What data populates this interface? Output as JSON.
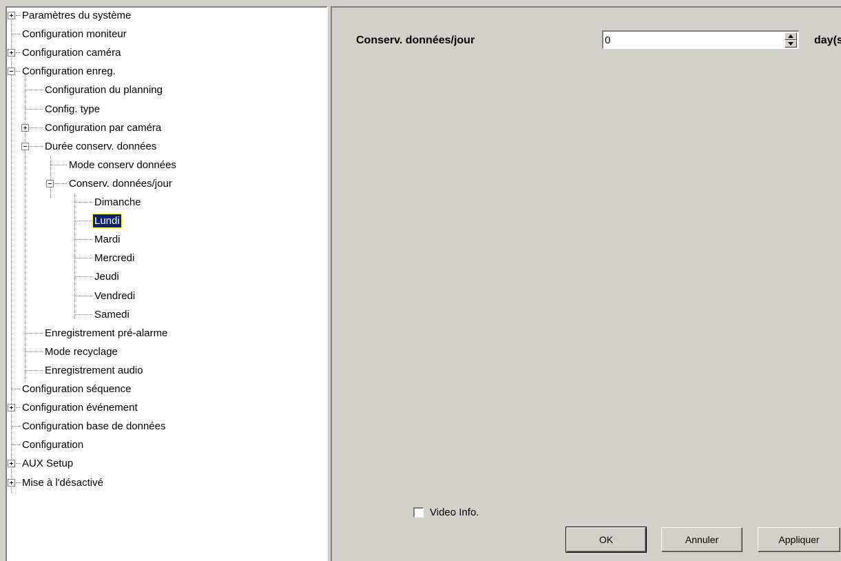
{
  "tree": {
    "nodes": [
      {
        "label": "Paramètres du système",
        "expander": "plus"
      },
      {
        "label": "Configuration moniteur",
        "expander": "none"
      },
      {
        "label": "Configuration caméra",
        "expander": "plus"
      },
      {
        "label": "Configuration enreg.",
        "expander": "minus"
      },
      {
        "label": "Configuration du planning",
        "expander": "none"
      },
      {
        "label": "Config. type",
        "expander": "none"
      },
      {
        "label": "Configuration par caméra",
        "expander": "plus"
      },
      {
        "label": "Durée conserv. données",
        "expander": "minus"
      },
      {
        "label": "Mode conserv données",
        "expander": "none"
      },
      {
        "label": "Conserv. données/jour",
        "expander": "minus"
      },
      {
        "label": "Dimanche",
        "expander": "none"
      },
      {
        "label": "Lundi",
        "expander": "none",
        "selected": true
      },
      {
        "label": "Mardi",
        "expander": "none"
      },
      {
        "label": "Mercredi",
        "expander": "none"
      },
      {
        "label": "Jeudi",
        "expander": "none"
      },
      {
        "label": "Vendredi",
        "expander": "none"
      },
      {
        "label": "Samedi",
        "expander": "none"
      },
      {
        "label": "Enregistrement pré-alarme",
        "expander": "none"
      },
      {
        "label": "Mode recyclage",
        "expander": "none"
      },
      {
        "label": "Enregistrement audio",
        "expander": "none"
      },
      {
        "label": "Configuration séquence",
        "expander": "none"
      },
      {
        "label": "Configuration événement",
        "expander": "plus"
      },
      {
        "label": "Configuration base de données",
        "expander": "none"
      },
      {
        "label": "Configuration",
        "expander": "none"
      },
      {
        "label": "AUX Setup",
        "expander": "plus"
      },
      {
        "label": "Mise à l'désactivé",
        "expander": "plus"
      }
    ]
  },
  "form": {
    "field_label": "Conserv. données/jour",
    "field_value": "0",
    "unit": "day(s)"
  },
  "video_info": {
    "label": "Video Info.",
    "checked": false
  },
  "buttons": {
    "ok": "OK",
    "cancel": "Annuler",
    "apply": "Appliquer"
  },
  "colors": {
    "dialog_bg": "#d4d0c8",
    "selection_bg": "#0a246a"
  }
}
